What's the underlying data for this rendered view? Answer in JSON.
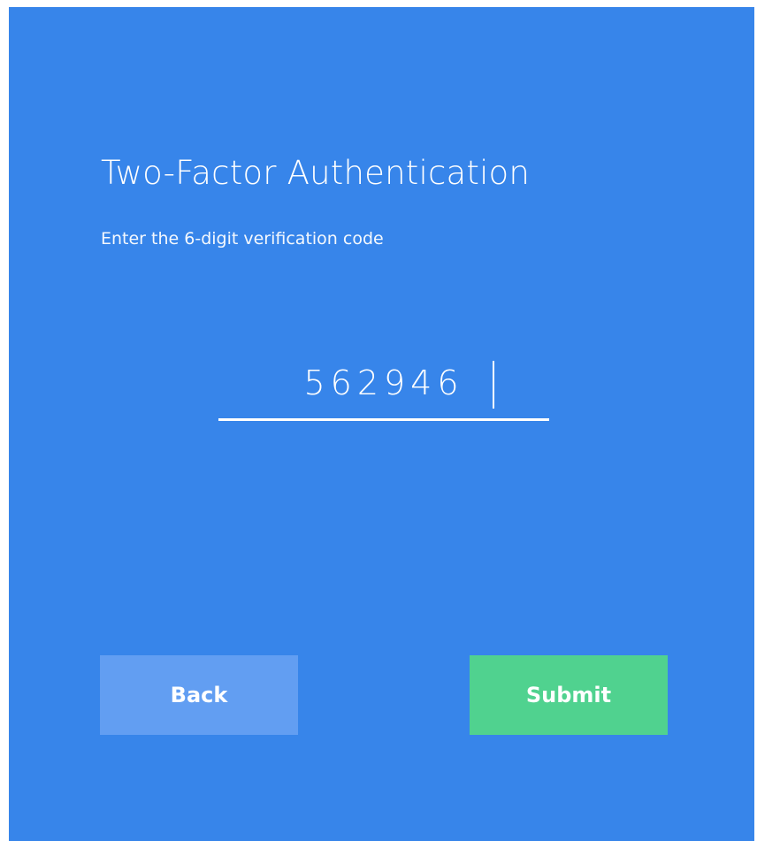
{
  "dialog": {
    "title": "Two-Factor Authentication",
    "subtitle": "Enter the 6-digit verification code",
    "code_input": {
      "value": "562946"
    },
    "back_label": "Back",
    "submit_label": "Submit"
  },
  "colors": {
    "panel_background": "#3785ea",
    "back_button": "#629ef2",
    "submit_button": "#50d28f",
    "text": "#ffffff"
  }
}
